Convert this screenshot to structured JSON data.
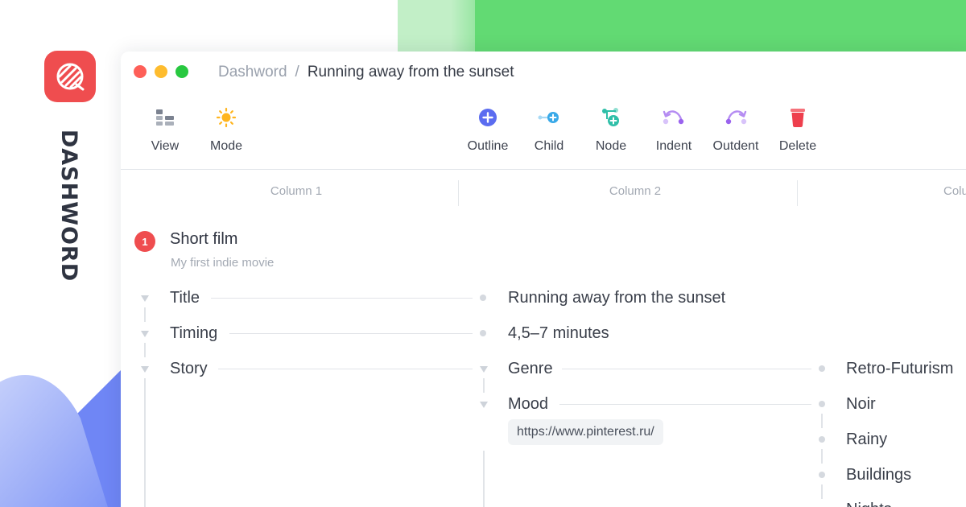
{
  "brand": {
    "name": "DASHWORD",
    "accent": "#ef4d4f"
  },
  "breadcrumb": {
    "root": "Dashword",
    "separator": "/",
    "current": "Running away from the sunset"
  },
  "toolbar": {
    "view": {
      "label": "View",
      "icon": "layout-icon"
    },
    "mode": {
      "label": "Mode",
      "icon": "sun-icon"
    },
    "outline": {
      "label": "Outline",
      "icon": "plus-circle-icon"
    },
    "child": {
      "label": "Child",
      "icon": "add-child-icon"
    },
    "node": {
      "label": "Node",
      "icon": "add-node-icon"
    },
    "indent": {
      "label": "Indent",
      "icon": "indent-icon"
    },
    "outdent": {
      "label": "Outdent",
      "icon": "outdent-icon"
    },
    "delete": {
      "label": "Delete",
      "icon": "trash-icon"
    }
  },
  "columns": [
    "Column 1",
    "Column 2",
    "Colu"
  ],
  "document": {
    "number": "1",
    "title": "Short film",
    "subtitle": "My first indie movie"
  },
  "nodes": {
    "title": {
      "label": "Title",
      "value": "Running away from the sunset"
    },
    "timing": {
      "label": "Timing",
      "value": "4,5–7 minutes"
    },
    "story": {
      "label": "Story",
      "genre": {
        "label": "Genre",
        "value": "Retro-Futurism"
      },
      "mood": {
        "label": "Mood",
        "link": "https://www.pinterest.ru/",
        "values": [
          "Noir",
          "Rainy",
          "Buildings",
          "Nights"
        ]
      }
    }
  },
  "colors": {
    "green": "#62da73",
    "green_light": "#c2efc7",
    "blue": "#6f86f5",
    "close": "#fe5f58",
    "minimize": "#febc2e",
    "zoom": "#28c840"
  }
}
